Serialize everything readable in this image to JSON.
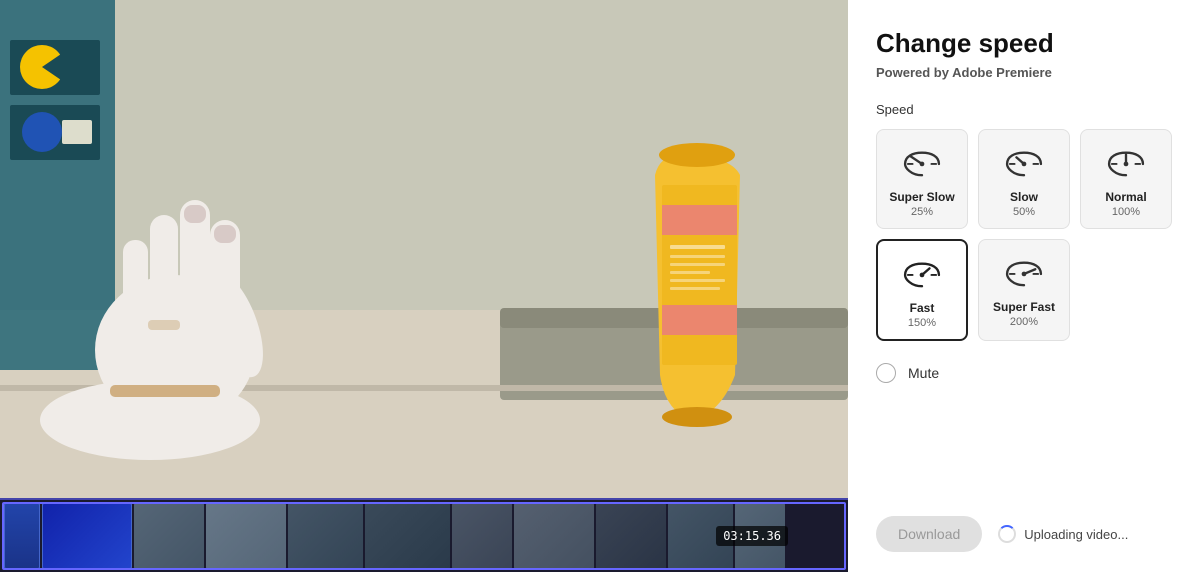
{
  "panel": {
    "title": "Change speed",
    "subtitle_prefix": "Powered by ",
    "subtitle_brand": "Adobe Premiere",
    "speed_label": "Speed",
    "mute_label": "Mute",
    "download_label": "Download",
    "upload_text": "Uploading video...",
    "timecode": "03:15.36"
  },
  "speed_options": [
    {
      "id": "super-slow",
      "name": "Super Slow",
      "percent": "25%",
      "selected": false,
      "icon": "super-slow"
    },
    {
      "id": "slow",
      "name": "Slow",
      "percent": "50%",
      "selected": false,
      "icon": "slow"
    },
    {
      "id": "normal",
      "name": "Normal",
      "percent": "100%",
      "selected": false,
      "icon": "normal"
    },
    {
      "id": "fast",
      "name": "Fast",
      "percent": "150%",
      "selected": true,
      "icon": "fast"
    },
    {
      "id": "super-fast",
      "name": "Super Fast",
      "percent": "200%",
      "selected": false,
      "icon": "super-fast"
    }
  ],
  "mute": {
    "active": false
  }
}
